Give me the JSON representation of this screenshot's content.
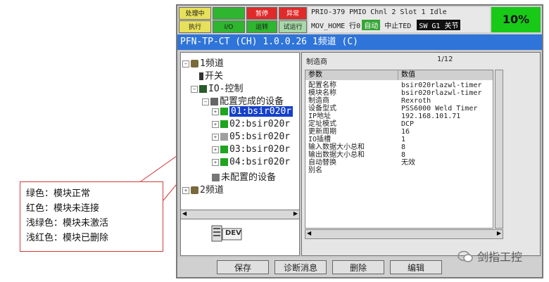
{
  "status": {
    "buttons": [
      {
        "label": "处理中"
      },
      {
        "label": ""
      },
      {
        "label": "暂停"
      },
      {
        "label": "异常"
      },
      {
        "label": "执行"
      },
      {
        "label": "I/O"
      },
      {
        "label": "运转"
      },
      {
        "label": "试运行"
      }
    ],
    "line1": "PRIO-379 PMIO Chnl 2 Slot 1 Idle",
    "line2_prefix": "MOV_HOME 行0",
    "badge_auto": "自动",
    "line2_mid": "中止TED",
    "badge_sw": "SW G1 关节",
    "percent": "10%"
  },
  "title": "PFN-TP-CT (CH) 1.0.0.26 1频道 (C)",
  "tree": {
    "items": [
      {
        "text": "1频道"
      },
      {
        "text": "开关"
      },
      {
        "text": "IO-控制"
      },
      {
        "text": "配置完成的设备"
      },
      {
        "text": "01:bsir020r"
      },
      {
        "text": "02:bsir020r"
      },
      {
        "text": "05:bsir020r"
      },
      {
        "text": "03:bsir020r"
      },
      {
        "text": "04:bsir020r"
      },
      {
        "text": "未配置的设备"
      },
      {
        "text": "2频道"
      }
    ],
    "dev_label": "DEV"
  },
  "details": {
    "header": "制造商",
    "page": "1/12",
    "col_param": "参数",
    "col_value": "数值",
    "rows": [
      {
        "param": "配置名称",
        "value": "bsir020rlazwl-timer"
      },
      {
        "param": "模块名称",
        "value": "bsir020rlazwl-timer"
      },
      {
        "param": "制造商",
        "value": "Rexroth"
      },
      {
        "param": "设备型式",
        "value": "PSS6000 Weld Timer"
      },
      {
        "param": "IP地址",
        "value": "192.168.101.71"
      },
      {
        "param": "定址模式",
        "value": "DCP"
      },
      {
        "param": "更新周期",
        "value": "16"
      },
      {
        "param": "IO插槽",
        "value": "1"
      },
      {
        "param": "输入数据大小总和",
        "value": "8"
      },
      {
        "param": "输出数据大小总和",
        "value": "8"
      },
      {
        "param": "自动替换",
        "value": "无效"
      },
      {
        "param": "别名",
        "value": ""
      }
    ]
  },
  "functions": {
    "save": "保存",
    "diag": "诊断消息",
    "delete": "删除",
    "edit": "编辑"
  },
  "legend": {
    "lines": [
      "绿色：模块正常",
      "红色：模块未连接",
      "浅绿色：模块未激活",
      "浅红色：模块已删除"
    ]
  },
  "watermark": "剑指工控",
  "colors": {
    "title_bg": "#2f74d8",
    "selected": "#1541c8",
    "ok_green": "#18c918",
    "alert_red": "#d23a3a"
  }
}
